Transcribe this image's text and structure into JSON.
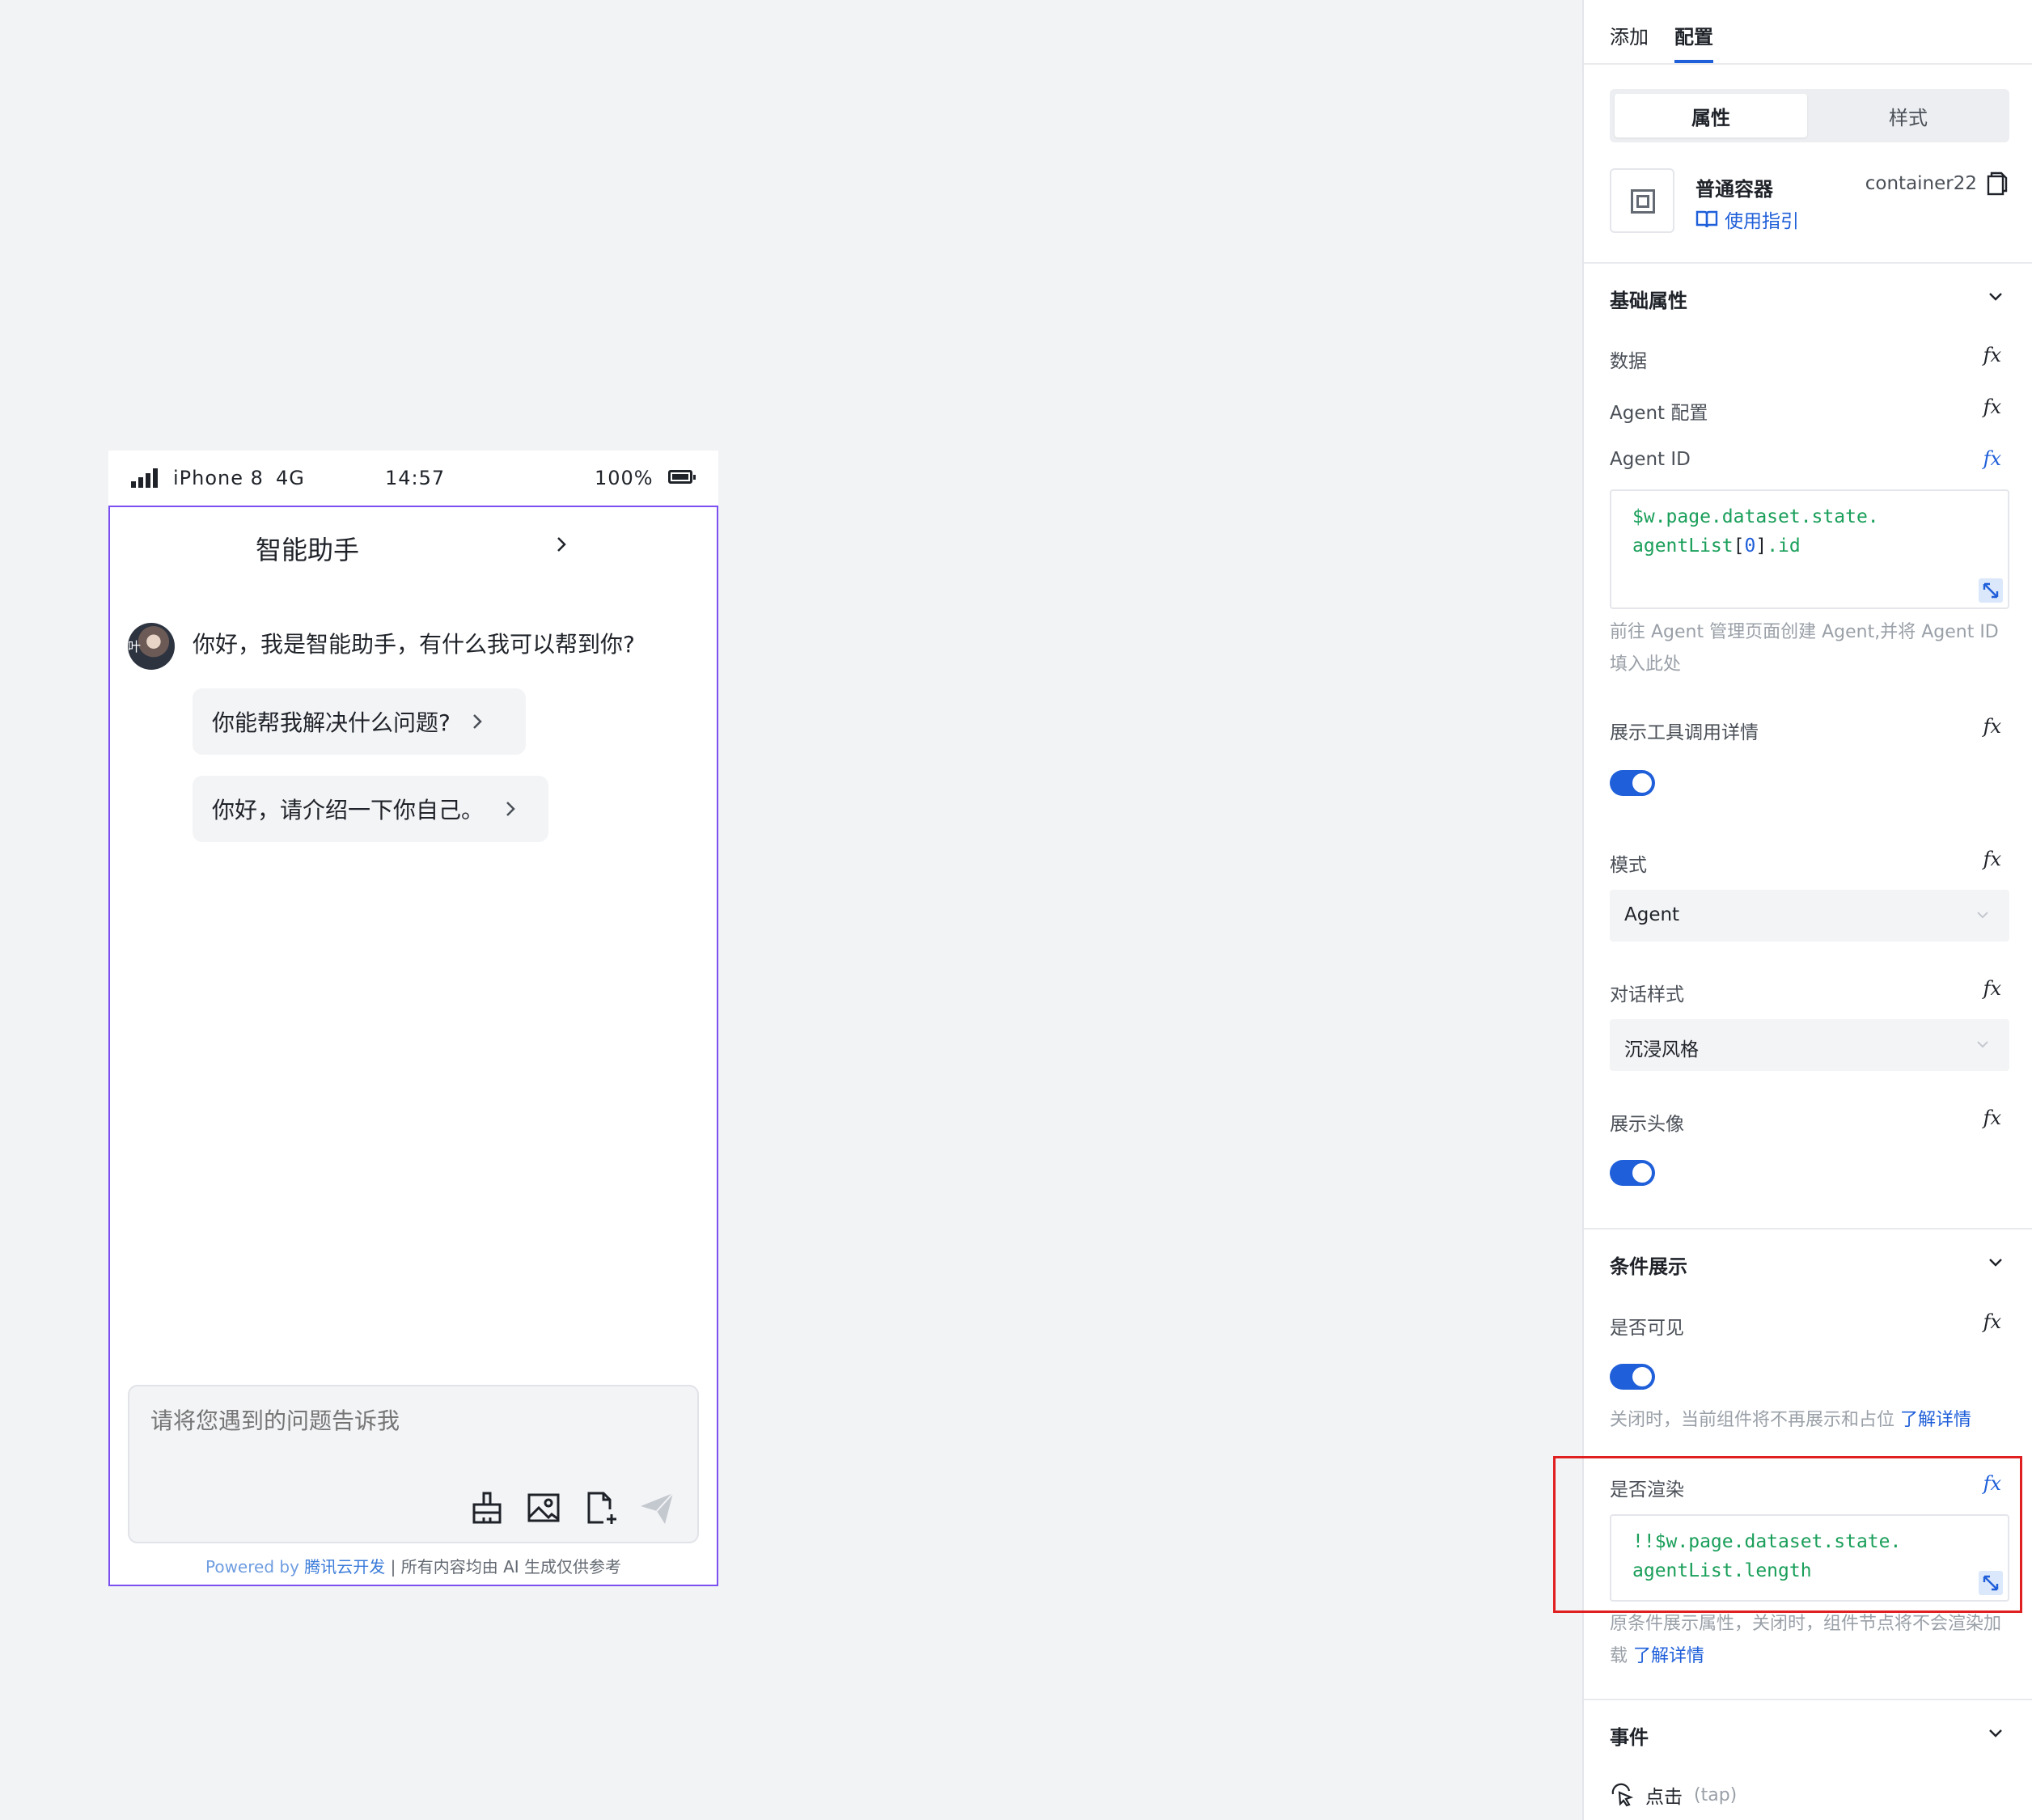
{
  "phone": {
    "status": {
      "device": "iPhone 8",
      "network": "4G",
      "time": "14:57",
      "battery": "100%"
    },
    "chat": {
      "title": "智能助手",
      "avatar_text": "叶",
      "greeting": "你好，我是智能助手，有什么我可以帮到你?",
      "suggestions": [
        "你能帮我解决什么问题?",
        "你好，请介绍一下你自己。"
      ],
      "input_placeholder": "请将您遇到的问题告诉我",
      "tool_icons": [
        "brush-icon",
        "image-icon",
        "file-add-icon",
        "send-icon"
      ],
      "footer": {
        "powered_prefix": "Powered by",
        "brand": "腾讯云开发",
        "separator": " | ",
        "note": "所有内容均由 AI 生成仅供参考"
      }
    },
    "accent_border": "#7b4ff0"
  },
  "panel": {
    "tabs": [
      {
        "label": "添加",
        "active": false
      },
      {
        "label": "配置",
        "active": true
      }
    ],
    "segment": {
      "options": [
        "属性",
        "样式"
      ],
      "active": "属性"
    },
    "component": {
      "name": "普通容器",
      "id": "container22",
      "guide_label": "使用指引"
    },
    "sections": {
      "basic": {
        "title": "基础属性",
        "data_label": "数据",
        "agent_config_label": "Agent 配置",
        "agent_id_label": "Agent ID",
        "agent_id_code": {
          "line1": "$w.page.dataset.state.",
          "line2_a": "agentList",
          "line2_b": "[",
          "line2_c": "0",
          "line2_d": "]",
          "line2_e": ".id"
        },
        "agent_id_hint": "前往 Agent 管理页面创建 Agent,并将 Agent ID 填入此处",
        "show_tool_label": "展示工具调用详情",
        "show_tool_on": true,
        "mode_label": "模式",
        "mode_value": "Agent",
        "dialog_style_label": "对话样式",
        "dialog_style_value": "沉浸风格",
        "show_avatar_label": "展示头像",
        "show_avatar_on": true
      },
      "condition": {
        "title": "条件展示",
        "visible_label": "是否可见",
        "visible_on": true,
        "visible_hint": "关闭时，当前组件将不再展示和占位",
        "visible_hint_link": "了解详情",
        "render_label": "是否渲染",
        "render_code": {
          "line1": "!!$w.page.dataset.state.",
          "line2": "agentList.length"
        },
        "render_hint": "原条件展示属性，关闭时，组件节点将不会渲染加载",
        "render_hint_link": "了解详情"
      },
      "events": {
        "title": "事件",
        "tap_label": "点击",
        "tap_sub": "(tap)"
      }
    },
    "fx_label": "fx",
    "colors": {
      "primary": "#1f5fd9",
      "code_green": "#1a9f5a",
      "highlight_red": "#e02020"
    }
  }
}
